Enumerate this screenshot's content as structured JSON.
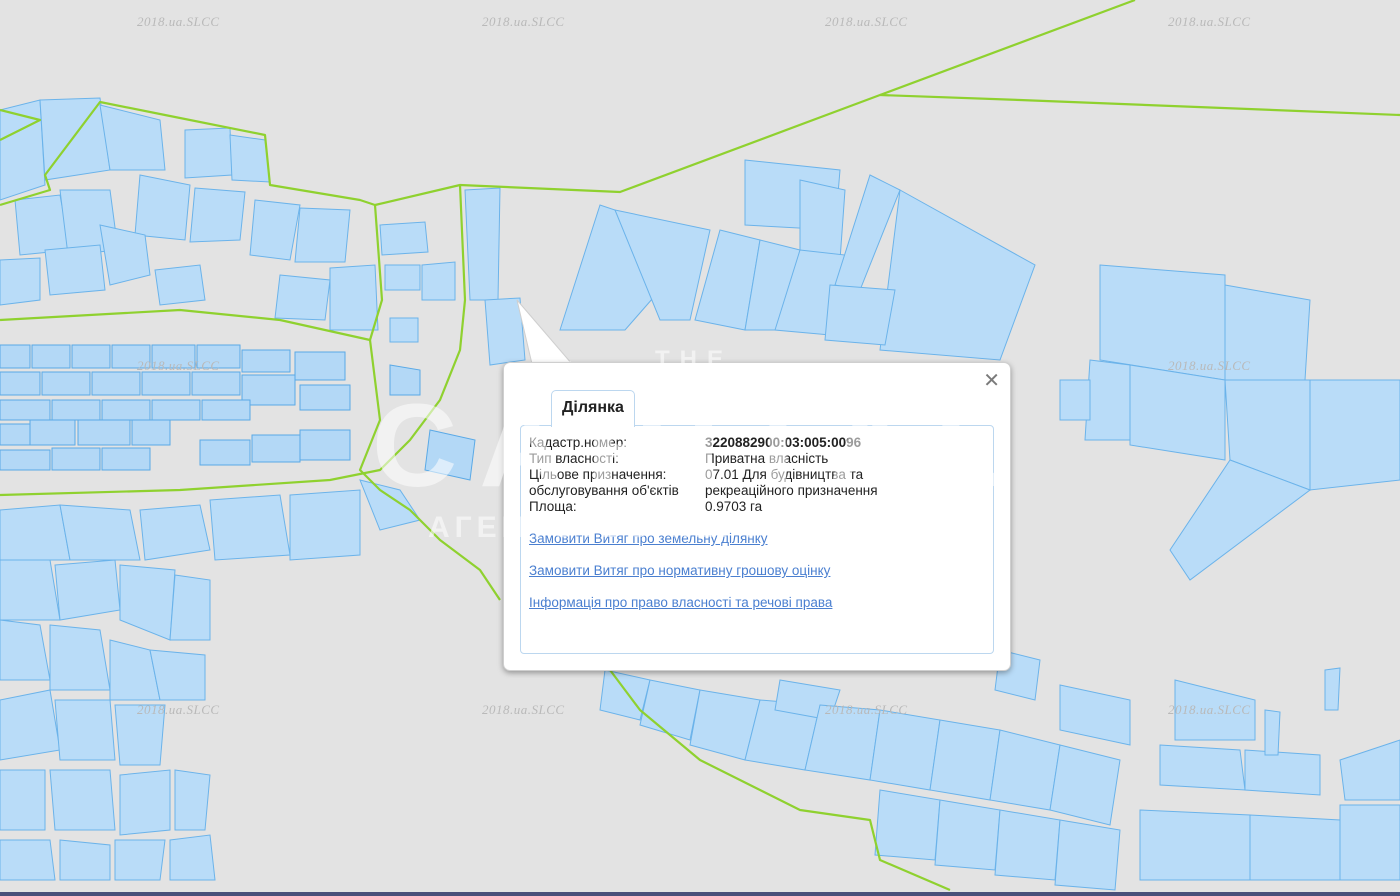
{
  "map": {
    "watermark": "2018.ua.SLCC",
    "boundary_color": "#8fd12f",
    "parcel_fill": "#b9dcf8",
    "parcel_stroke": "#6bb3ea",
    "background": "#e3e3e3"
  },
  "agency_watermark": {
    "small": "THE",
    "big": "CAPITAL",
    "sub": "АГЕНТСТВО НЕРУХОМОСТІ"
  },
  "popup": {
    "close_icon": "close-icon",
    "tab_label": "Ділянка",
    "fields": [
      {
        "label": "Кадастр.номер:",
        "value": "3220882900:03:005:0096"
      },
      {
        "label": "Тип власності:",
        "value": "Приватна власність"
      },
      {
        "label": "Цільове призначення: обслуговування об'єктів",
        "value": "07.01 Для будівництва та рекреаційного призначення"
      },
      {
        "label": "Площа:",
        "value": "0.9703 га"
      }
    ],
    "links": [
      "Замовити Витяг про земельну ділянку",
      "Замовити Витяг про нормативну грошову оцінку",
      "Інформація про право власності та речові права"
    ]
  }
}
